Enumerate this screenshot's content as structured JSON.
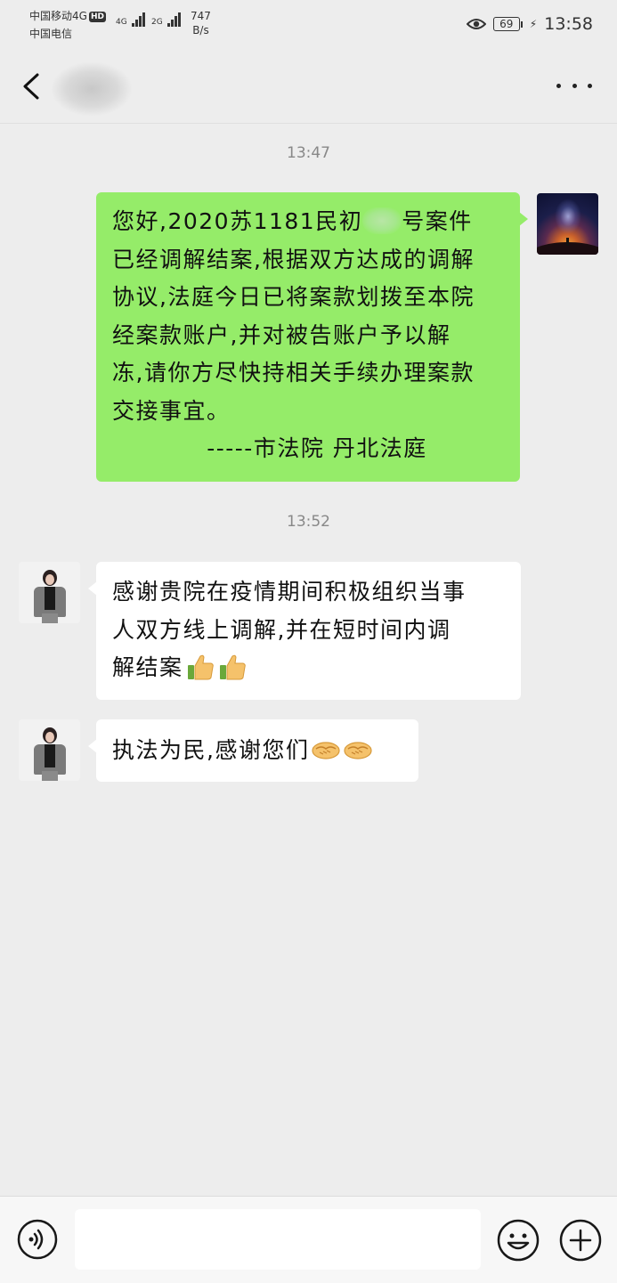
{
  "status_bar": {
    "carrier_1": "中国移动4G",
    "hd_badge": "HD",
    "carrier_2": "中国电信",
    "signal_1": "4G",
    "signal_2": "2G",
    "speed_value": "747",
    "speed_unit": "B/s",
    "battery": "69",
    "time": "13:58"
  },
  "chat": {
    "messages": [
      {
        "timestamp": "13:47",
        "sender": "me",
        "lines": [
          "您好,2020苏1181民初",
          "号案件",
          "已经调解结案,根据双方达成的调解",
          "协议,法庭今日已将案款划拨至本院",
          "经案款账户,并对被告账户予以解",
          "冻,请你方尽快持相关手续办理案款",
          "交接事宜。",
          "-----市法院 丹北法庭"
        ]
      },
      {
        "timestamp": "13:52",
        "sender": "peer",
        "lines": [
          "感谢贵院在疫情期间积极组织当事",
          "人双方线上调解,并在短时间内调",
          "解结案"
        ],
        "emoji": "thumbs-up"
      },
      {
        "sender": "peer",
        "lines": [
          "执法为民,感谢您们"
        ],
        "emoji": "handshake"
      }
    ]
  },
  "input_bar": {
    "placeholder": "",
    "icons": [
      "voice-icon",
      "emoji-icon",
      "plus-icon"
    ]
  }
}
